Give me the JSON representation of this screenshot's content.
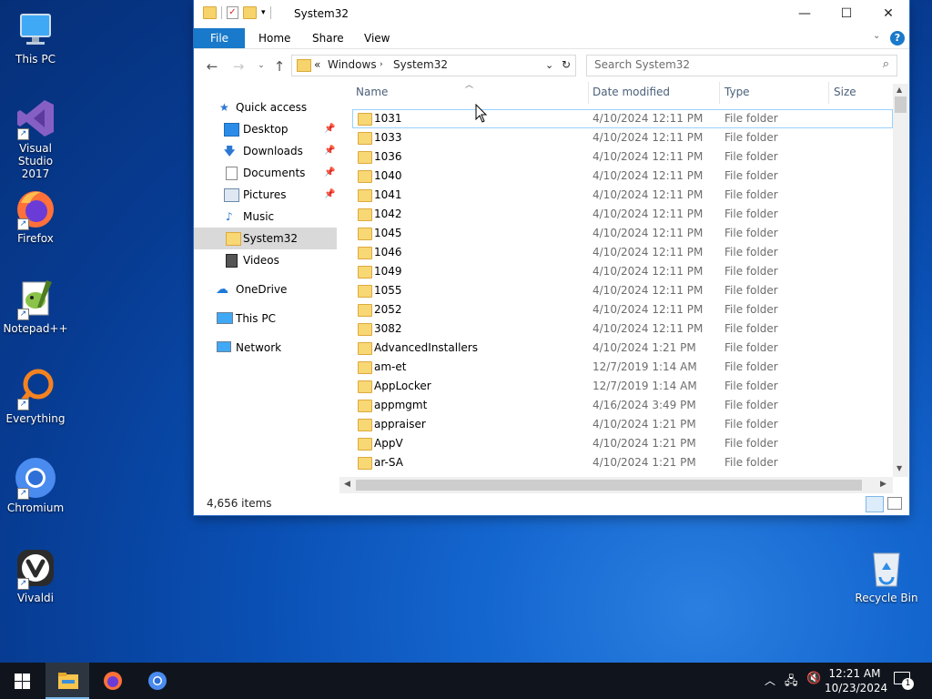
{
  "desktop": {
    "icons": [
      {
        "label": "This PC"
      },
      {
        "label": "Visual Studio 2017"
      },
      {
        "label": "Firefox"
      },
      {
        "label": "Notepad++"
      },
      {
        "label": "Everything"
      },
      {
        "label": "Chromium"
      },
      {
        "label": "Vivaldi"
      },
      {
        "label": "Recycle Bin"
      }
    ]
  },
  "window": {
    "title": "System32",
    "ribbon_tabs": [
      "File",
      "Home",
      "Share",
      "View"
    ],
    "address": {
      "prefix": "«",
      "crumbs": [
        "Windows",
        "System32"
      ]
    },
    "search_placeholder": "Search System32",
    "nav": {
      "quick_access": "Quick access",
      "items": [
        {
          "label": "Desktop",
          "pinned": true
        },
        {
          "label": "Downloads",
          "pinned": true
        },
        {
          "label": "Documents",
          "pinned": true
        },
        {
          "label": "Pictures",
          "pinned": true
        },
        {
          "label": "Music",
          "pinned": false
        },
        {
          "label": "System32",
          "pinned": false
        },
        {
          "label": "Videos",
          "pinned": false
        }
      ],
      "onedrive": "OneDrive",
      "this_pc": "This PC",
      "network": "Network"
    },
    "columns": [
      "Name",
      "Date modified",
      "Type",
      "Size"
    ],
    "files": [
      {
        "name": "1031",
        "date": "4/10/2024 12:11 PM",
        "type": "File folder"
      },
      {
        "name": "1033",
        "date": "4/10/2024 12:11 PM",
        "type": "File folder"
      },
      {
        "name": "1036",
        "date": "4/10/2024 12:11 PM",
        "type": "File folder"
      },
      {
        "name": "1040",
        "date": "4/10/2024 12:11 PM",
        "type": "File folder"
      },
      {
        "name": "1041",
        "date": "4/10/2024 12:11 PM",
        "type": "File folder"
      },
      {
        "name": "1042",
        "date": "4/10/2024 12:11 PM",
        "type": "File folder"
      },
      {
        "name": "1045",
        "date": "4/10/2024 12:11 PM",
        "type": "File folder"
      },
      {
        "name": "1046",
        "date": "4/10/2024 12:11 PM",
        "type": "File folder"
      },
      {
        "name": "1049",
        "date": "4/10/2024 12:11 PM",
        "type": "File folder"
      },
      {
        "name": "1055",
        "date": "4/10/2024 12:11 PM",
        "type": "File folder"
      },
      {
        "name": "2052",
        "date": "4/10/2024 12:11 PM",
        "type": "File folder"
      },
      {
        "name": "3082",
        "date": "4/10/2024 12:11 PM",
        "type": "File folder"
      },
      {
        "name": "AdvancedInstallers",
        "date": "4/10/2024 1:21 PM",
        "type": "File folder"
      },
      {
        "name": "am-et",
        "date": "12/7/2019 1:14 AM",
        "type": "File folder"
      },
      {
        "name": "AppLocker",
        "date": "12/7/2019 1:14 AM",
        "type": "File folder"
      },
      {
        "name": "appmgmt",
        "date": "4/16/2024 3:49 PM",
        "type": "File folder"
      },
      {
        "name": "appraiser",
        "date": "4/10/2024 1:21 PM",
        "type": "File folder"
      },
      {
        "name": "AppV",
        "date": "4/10/2024 1:21 PM",
        "type": "File folder"
      },
      {
        "name": "ar-SA",
        "date": "4/10/2024 1:21 PM",
        "type": "File folder"
      }
    ],
    "status": "4,656 items"
  },
  "taskbar": {
    "time": "12:21 AM",
    "date": "10/23/2024",
    "notification_count": "1"
  },
  "colors": {
    "accent": "#1979ca",
    "folder": "#f8d775",
    "taskbar": "#10151d"
  }
}
